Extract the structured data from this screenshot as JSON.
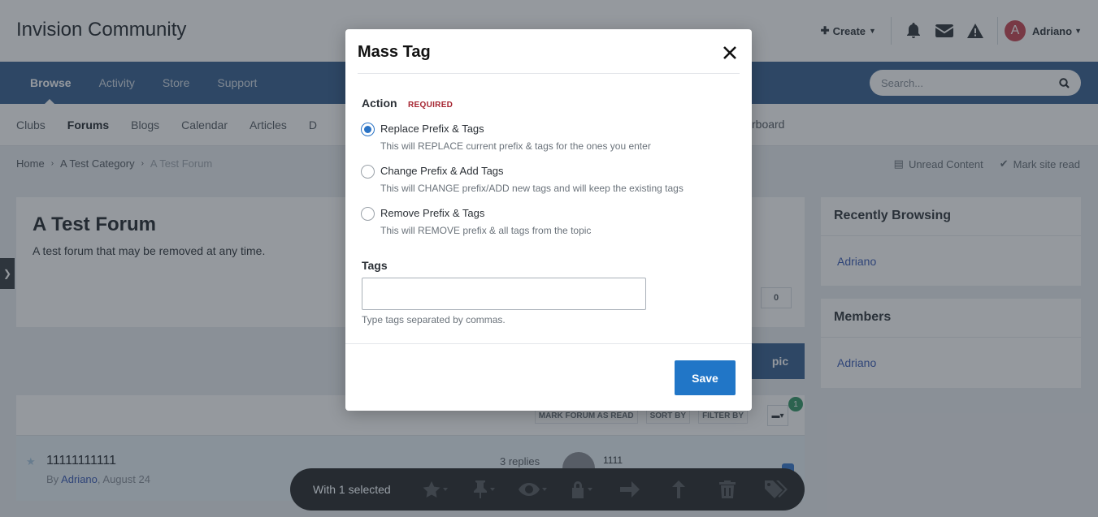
{
  "header": {
    "site_title": "Invision Community",
    "create_label": "Create",
    "user_initial": "A",
    "user_name": "Adriano"
  },
  "primary_nav": [
    "Browse",
    "Activity",
    "Store",
    "Support"
  ],
  "search": {
    "placeholder": "Search..."
  },
  "secondary_nav": [
    "Clubs",
    "Forums",
    "Blogs",
    "Calendar",
    "Articles",
    "D"
  ],
  "secondary_nav_extra": "rboard",
  "breadcrumb": [
    "Home",
    "A Test Category",
    "A Test Forum"
  ],
  "crumb_actions": {
    "unread": "Unread Content",
    "mark_read": "Mark site read"
  },
  "forum": {
    "title": "A Test Forum",
    "description": "A test forum that may be removed at any time.",
    "follow_count": "0",
    "start_topic_fragment": "pic"
  },
  "list_header": {
    "mark_read": "MARK FORUM AS READ",
    "sort_by": "SORT BY",
    "filter_by": "FILTER BY",
    "selected_badge": "1"
  },
  "topic": {
    "title": "11111111111",
    "by": "By",
    "author": "Adriano",
    "date": ", August 24",
    "replies": "3 replies",
    "last_poster": "1111",
    "avatar_digit": "1"
  },
  "sidebar": {
    "recent_title": "Recently Browsing",
    "recent_user": "Adriano",
    "members_title": "Members",
    "members_user": "Adriano"
  },
  "modal": {
    "title": "Mass Tag",
    "action_label": "Action",
    "required_label": "REQUIRED",
    "options": [
      {
        "label": "Replace Prefix & Tags",
        "desc": "This will REPLACE current prefix & tags for the ones you enter",
        "checked": true
      },
      {
        "label": "Change Prefix & Add Tags",
        "desc": "This will CHANGE prefix/ADD new tags and will keep the existing tags",
        "checked": false
      },
      {
        "label": "Remove Prefix & Tags",
        "desc": "This will REMOVE prefix & all tags from the topic",
        "checked": false
      }
    ],
    "tags_label": "Tags",
    "tags_value": "",
    "tags_hint": "Type tags separated by commas.",
    "save_label": "Save"
  },
  "modbar": {
    "selected_text": "With 1 selected",
    "icons": [
      "star-icon",
      "pin-icon",
      "eye-icon",
      "lock-icon",
      "move-arrow-icon",
      "merge-icon",
      "trash-icon",
      "tags-icon"
    ]
  }
}
